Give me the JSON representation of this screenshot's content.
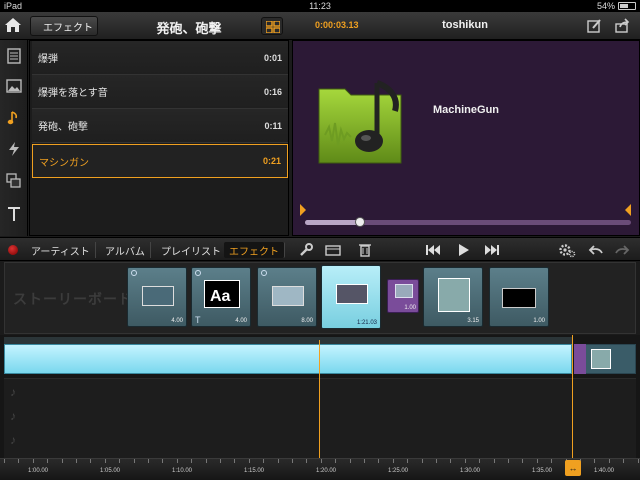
{
  "status": {
    "carrier": "iPad",
    "time": "11:23",
    "battery": "54%",
    "battery_level": 0.54
  },
  "nav": {
    "back_label": "エフェクト",
    "title": "発砲、砲撃",
    "timecode": "0:00:03.13",
    "project_title": "toshikun"
  },
  "effects_list": [
    {
      "name": "爆弾",
      "duration": "0:01"
    },
    {
      "name": "爆弾を落とす音",
      "duration": "0:16"
    },
    {
      "name": "発砲、砲撃",
      "duration": "0:11"
    },
    {
      "name": "マシンガン",
      "duration": "0:21",
      "selected": true
    }
  ],
  "preview": {
    "clip_name": "MachineGun",
    "progress": 0.17
  },
  "media_tabs": [
    {
      "label": "アーティスト"
    },
    {
      "label": "アルバム"
    },
    {
      "label": "プレイリスト"
    },
    {
      "label": "エフェクト",
      "active": true
    }
  ],
  "storyboard": {
    "label": "ストーリーボード",
    "thumbs": [
      {
        "duration": "4.00"
      },
      {
        "duration": "4.00"
      },
      {
        "duration": "8.00"
      },
      {
        "duration": "1:21.03"
      },
      {
        "duration": "1.00"
      },
      {
        "duration": "3.15"
      },
      {
        "duration": "1.00"
      }
    ]
  },
  "ruler": {
    "labels": [
      "1:00.00",
      "1:05.00",
      "1:10.00",
      "1:15.00",
      "1:20.00",
      "1:25.00",
      "1:30.00",
      "1:35.00",
      "1:40.00"
    ]
  },
  "colors": {
    "accent": "#f0a020",
    "preview_bg": "#2c1936",
    "clip": "#7ad8ee",
    "transition": "#7a4c9a"
  }
}
